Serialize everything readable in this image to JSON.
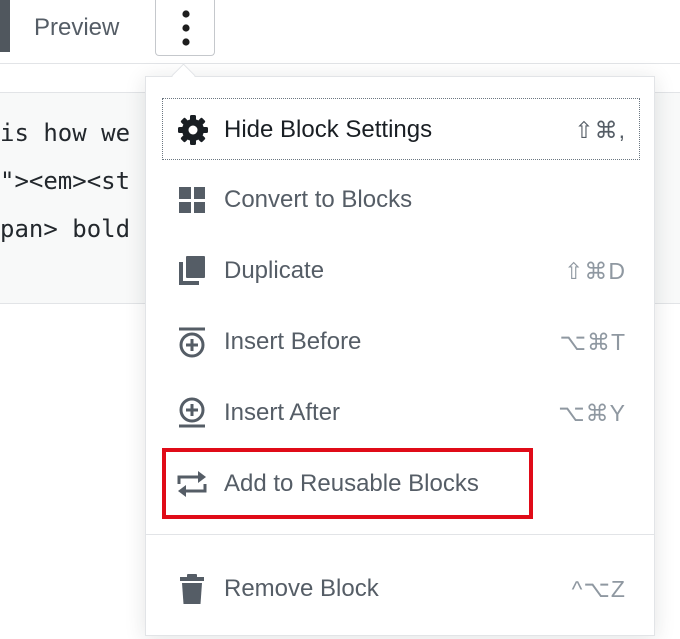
{
  "toolbar": {
    "preview_label": "Preview",
    "more_icon": "vertical-ellipsis-icon"
  },
  "code_editor": {
    "lines": [
      "is how we",
      "\"><em><st",
      "pan> bold"
    ]
  },
  "menu": {
    "items": [
      {
        "id": "hide-block-settings",
        "label": "Hide Block Settings",
        "shortcut": "⇧⌘,",
        "icon": "gear-icon",
        "focused": true
      },
      {
        "id": "convert-to-blocks",
        "label": "Convert to Blocks",
        "shortcut": "",
        "icon": "grid-icon"
      },
      {
        "id": "duplicate",
        "label": "Duplicate",
        "shortcut": "⇧⌘D",
        "icon": "duplicate-icon"
      },
      {
        "id": "insert-before",
        "label": "Insert Before",
        "shortcut": "⌥⌘T",
        "icon": "insert-before-icon"
      },
      {
        "id": "insert-after",
        "label": "Insert After",
        "shortcut": "⌥⌘Y",
        "icon": "insert-after-icon"
      },
      {
        "id": "add-to-reusable-blocks",
        "label": "Add to Reusable Blocks",
        "shortcut": "",
        "icon": "reusable-blocks-icon"
      },
      {
        "id": "remove-block",
        "label": "Remove Block",
        "shortcut": "^⌥Z",
        "icon": "trash-icon"
      }
    ]
  },
  "colors": {
    "highlight": "#e00b18",
    "menu_text": "#555d66",
    "focused_text": "#191e23"
  }
}
